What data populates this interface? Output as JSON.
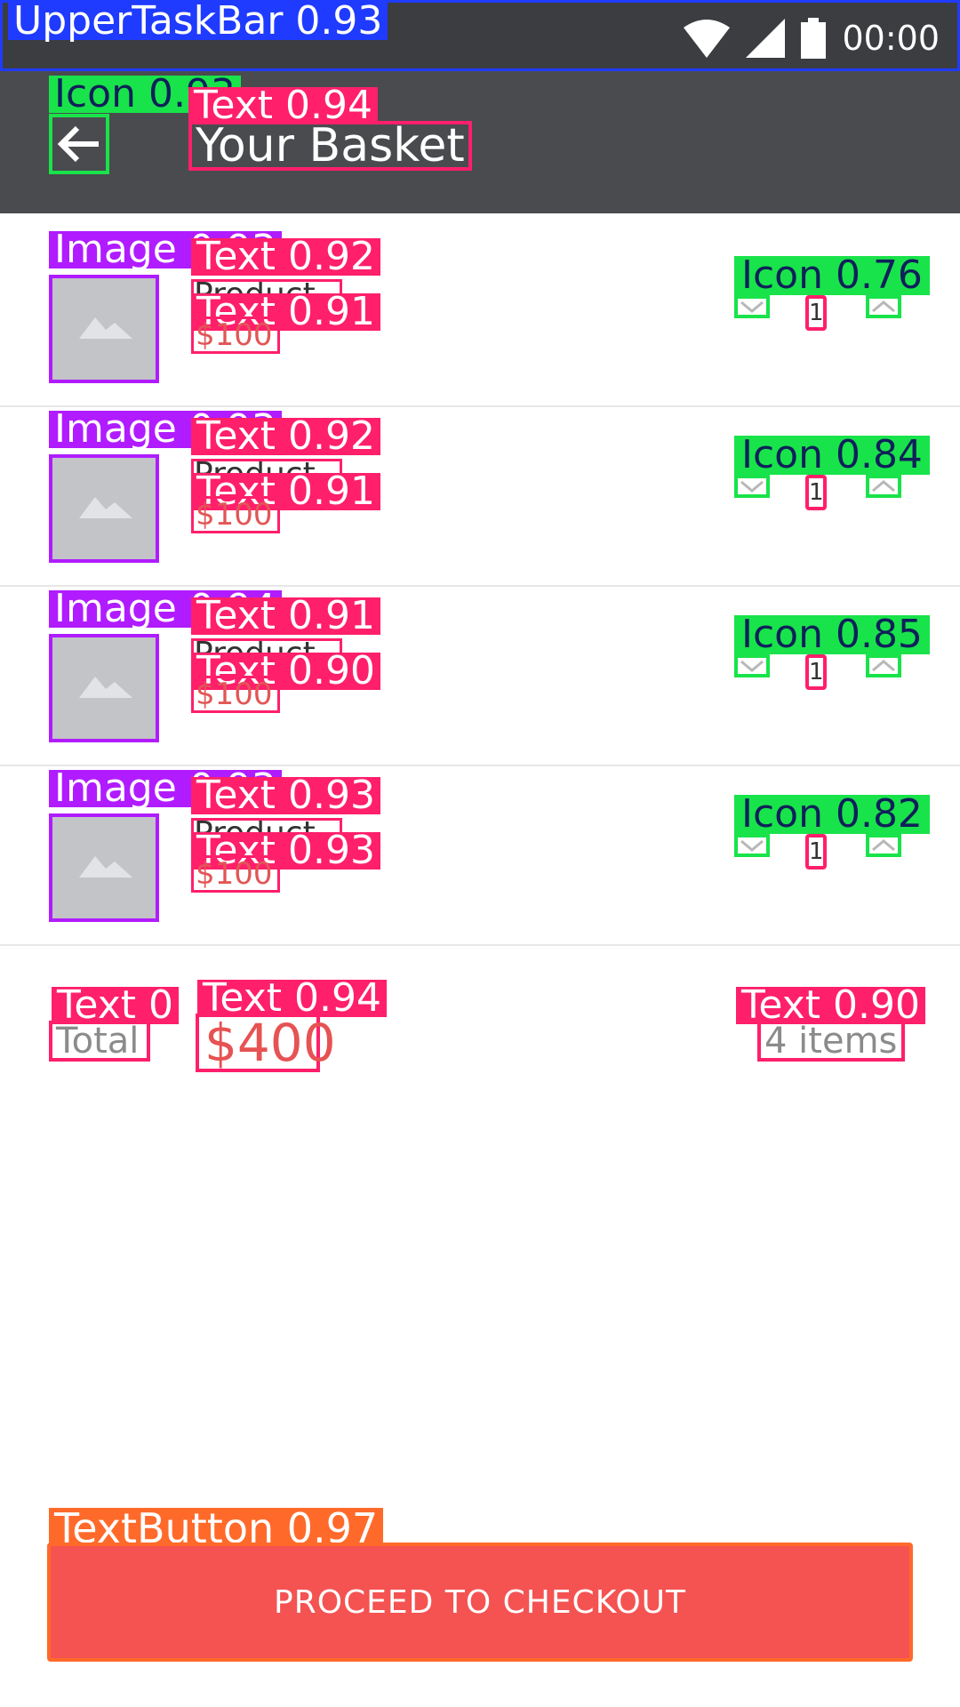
{
  "statusbar": {
    "detection_label": "UpperTaskBar 0.93",
    "time": "00:00",
    "icons": [
      "wifi-icon",
      "signal-icon",
      "battery-icon"
    ]
  },
  "appbar": {
    "icon_label": "Icon 0.93",
    "title_label": "Text 0.94",
    "title": "Your Basket"
  },
  "items": [
    {
      "image_label": "Image 0.93",
      "name_label": "Text 0.92",
      "name": "Product",
      "price_label": "Text 0.91",
      "price": "$100",
      "qty": "1",
      "icon_label": "Icon 0.76"
    },
    {
      "image_label": "Image 0.93",
      "name_label": "Text 0.92",
      "name": "Product",
      "price_label": "Text 0.91",
      "price": "$100",
      "qty": "1",
      "icon_label": "Icon 0.84"
    },
    {
      "image_label": "Image 0.94",
      "name_label": "Text 0.91",
      "name": "Product",
      "price_label": "Text 0.90",
      "price": "$100",
      "qty": "1",
      "icon_label": "Icon 0.85"
    },
    {
      "image_label": "Image 0.93",
      "name_label": "Text 0.93",
      "name": "Product",
      "price_label": "Text 0.93",
      "price": "$100",
      "qty": "1",
      "icon_label": "Icon 0.82"
    }
  ],
  "totals": {
    "total_label_det": "Text 0",
    "total_label": "Total",
    "total_value_det": "Text 0.94",
    "total_value": "$400",
    "items_det": "Text 0.90",
    "items_count": "4 items"
  },
  "checkout": {
    "detection_label": "TextButton 0.97",
    "label": "PROCEED TO CHECKOUT"
  },
  "colors": {
    "statusbar": "#3b3d40",
    "appbar": "#494b4f",
    "checkout": "#f45352",
    "price": "#e25656"
  }
}
